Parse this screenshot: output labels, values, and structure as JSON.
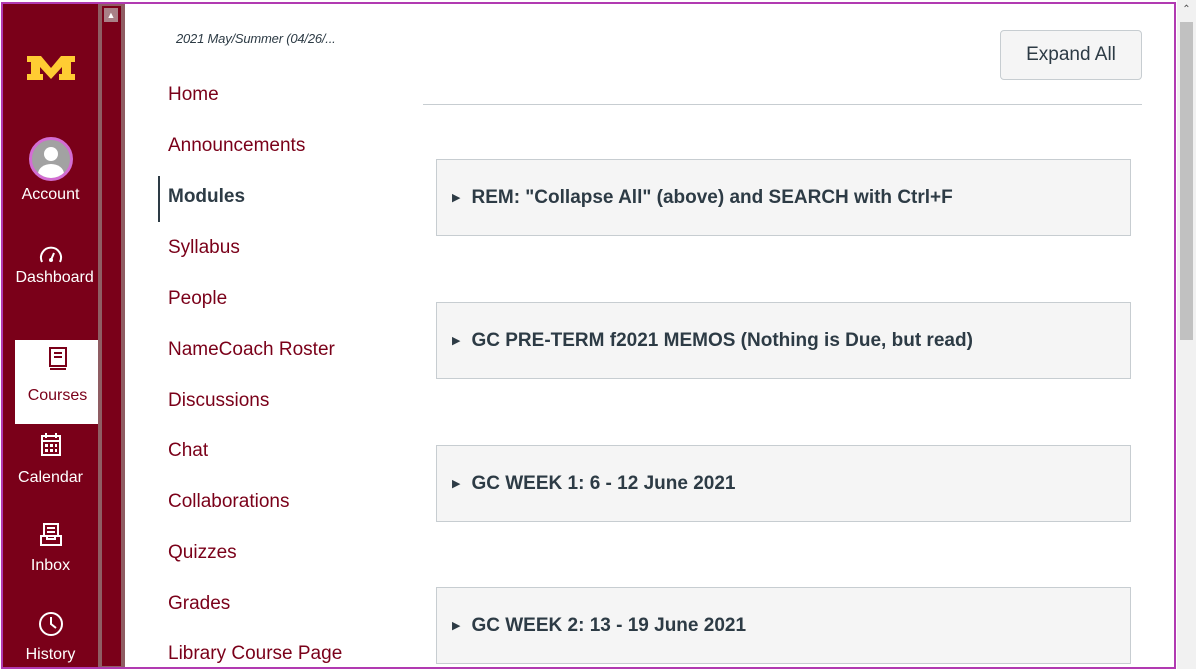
{
  "global_nav": {
    "logo_icon": "university-m-logo",
    "items": [
      {
        "label": "Account",
        "icon": "user-avatar-icon"
      },
      {
        "label": "Dashboard",
        "icon": "dashboard-gauge-icon"
      },
      {
        "label": "Courses",
        "icon": "book-icon",
        "active": true
      },
      {
        "label": "Calendar",
        "icon": "calendar-icon"
      },
      {
        "label": "Inbox",
        "icon": "inbox-icon"
      },
      {
        "label": "History",
        "icon": "clock-icon"
      }
    ]
  },
  "course_nav": {
    "term": "2021 May/Summer (04/26/...",
    "items": [
      "Home",
      "Announcements",
      "Modules",
      "Syllabus",
      "People",
      "NameCoach Roster",
      "Discussions",
      "Chat",
      "Collaborations",
      "Quizzes",
      "Grades",
      "Library Course Page"
    ],
    "active": "Modules"
  },
  "main": {
    "expand_all_label": "Expand All",
    "modules": [
      "REM: \"Collapse All\" (above) and SEARCH with Ctrl+F",
      "GC PRE-TERM f2021 MEMOS (Nothing is Due, but read)",
      "GC WEEK 1: 6 - 12 June 2021",
      "GC WEEK 2: 13 - 19 June 2021"
    ]
  },
  "colors": {
    "brand": "#7a0019",
    "gold": "#ffcc33",
    "text": "#2d3b45",
    "frame": "#b13ab1"
  }
}
